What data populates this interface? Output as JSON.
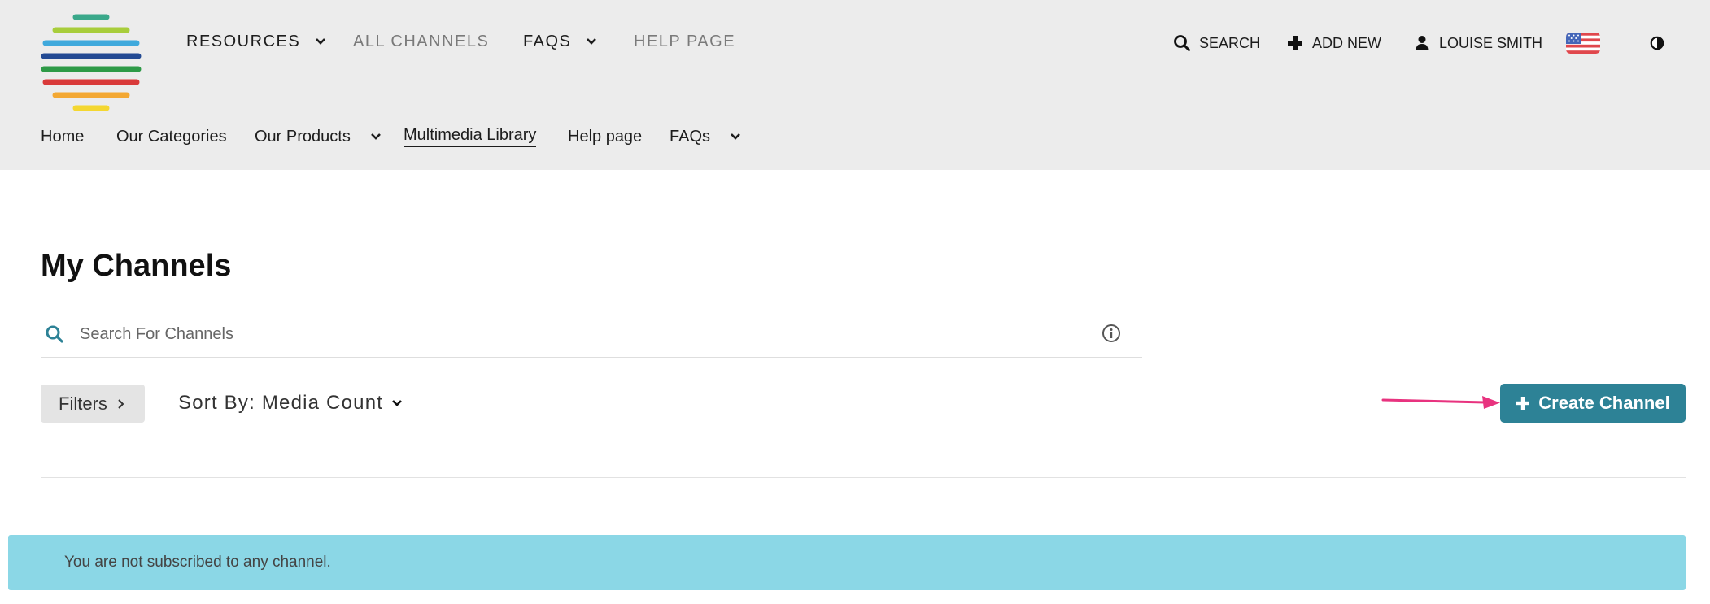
{
  "header": {
    "top_nav": [
      {
        "label": "RESOURCES",
        "dropdown": true
      },
      {
        "label": "ALL CHANNELS",
        "dropdown": false
      },
      {
        "label": "FAQS",
        "dropdown": true
      },
      {
        "label": "HELP PAGE",
        "dropdown": false
      }
    ],
    "right_nav": {
      "search_label": "SEARCH",
      "add_new_label": "ADD NEW",
      "user_label": "LOUISE SMITH",
      "language_flag": "us-flag-icon",
      "contrast_toggle": "contrast-icon"
    },
    "sub_nav": [
      {
        "label": "Home"
      },
      {
        "label": "Our Categories"
      },
      {
        "label": "Our Products",
        "dropdown": true
      },
      {
        "label": "Multimedia Library",
        "active": true
      },
      {
        "label": "Help page"
      },
      {
        "label": "FAQs",
        "dropdown": true
      }
    ]
  },
  "main": {
    "title": "My Channels",
    "search": {
      "placeholder": "Search For Channels",
      "value": ""
    },
    "filters_label": "Filters",
    "sort_label": "Sort By: Media Count",
    "create_label": "Create Channel",
    "alert_text": "You are not subscribed to any channel."
  },
  "colors": {
    "header_bg": "#ececec",
    "accent": "#2d8296",
    "alert_bg": "#8bd7e6",
    "annotation_arrow": "#e8337f"
  }
}
